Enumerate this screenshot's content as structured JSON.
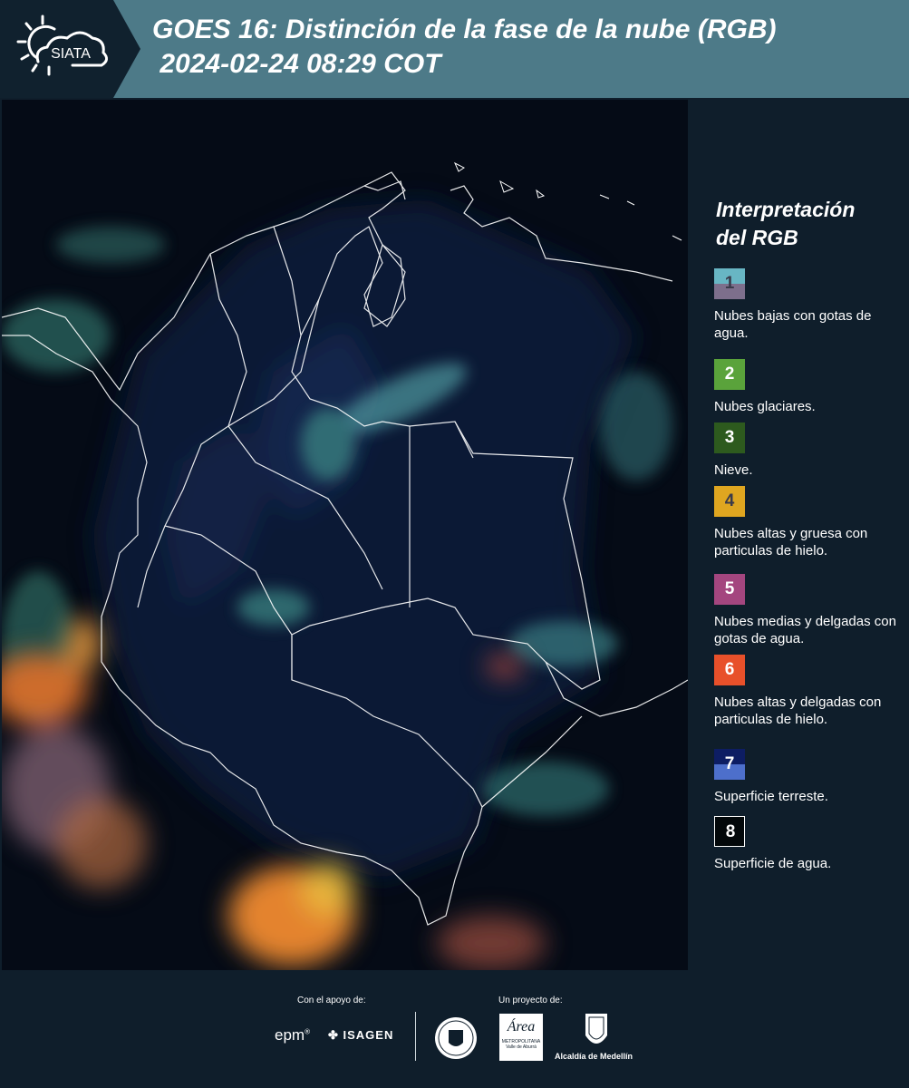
{
  "header": {
    "logo_text": "SIATA",
    "title_line1": "GOES 16: Distinción de la fase de la nube (RGB)",
    "title_line2": " 2024-02-24 08:29 COT"
  },
  "legend": {
    "title_line1": "Interpretación",
    "title_line2": "del RGB",
    "items": [
      {
        "number": "1",
        "label": "Nubes bajas con gotas de agua.",
        "color_top": "#68b6c4",
        "color_bottom": "#7d6f8c"
      },
      {
        "number": "2",
        "label": "Nubes glaciares.",
        "color_top": "#5aa33b",
        "color_bottom": "#5aa33b"
      },
      {
        "number": "3",
        "label": "Nieve.",
        "color_top": "#2d5a1e",
        "color_bottom": "#2d5a1e"
      },
      {
        "number": "4",
        "label": "Nubes altas y gruesa con particulas de hielo.",
        "color_top": "#dfa620",
        "color_bottom": "#dfa620"
      },
      {
        "number": "5",
        "label": "Nubes medias y delgadas con gotas de agua.",
        "color_top": "#a4467f",
        "color_bottom": "#a4467f"
      },
      {
        "number": "6",
        "label": "Nubes altas y delgadas con particulas de hielo.",
        "color_top": "#e8502a",
        "color_bottom": "#e8502a"
      },
      {
        "number": "7",
        "label": "Superficie terreste.",
        "color_top": "#0d1d63",
        "color_bottom": "#4d6fcb"
      },
      {
        "number": "8",
        "label": "Superficie de agua.",
        "color_top": "#03080a",
        "color_bottom": "#03080a"
      }
    ]
  },
  "footer": {
    "support_label": "Con el apoyo de:",
    "project_label": "Un proyecto de:",
    "sponsor_epm": "epm",
    "sponsor_isagen": "ISAGEN",
    "area_logo_text": "Área",
    "area_logo_sub": "METROPOLITANA",
    "area_logo_sub2": "Valle de Aburrá",
    "alcaldia": "Alcaldía de Medellín"
  }
}
